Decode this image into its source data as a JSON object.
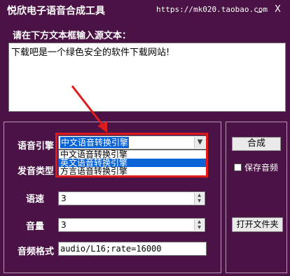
{
  "window": {
    "title": "悦欣电子语音合成工具",
    "url": "https://mk020.taobao.com",
    "minimize": "_",
    "close": "X"
  },
  "source": {
    "prompt": "请在下方文本框输入源文本：",
    "text": "下载吧是一个绿色安全的软件下载网站!"
  },
  "engine": {
    "label": "语音引擎",
    "selected": "中文语音转换引擎",
    "options": [
      "中文语音转换引擎",
      "英文语音转换引擎",
      "方言语音转换引擎"
    ],
    "highlighted_index": 1
  },
  "voice_type": {
    "label": "发音类型"
  },
  "speed": {
    "label": "语速",
    "value": "3"
  },
  "volume": {
    "label": "音量",
    "value": "3"
  },
  "format": {
    "label": "音频格式",
    "value": "audio/L16;rate=16000"
  },
  "buttons": {
    "synthesize": "合成",
    "save_audio": "保存音频",
    "open_folder": "打开文件夹"
  },
  "icons": {
    "dropdown": "chevron-down-icon",
    "spin_up": "arrow-up-icon",
    "spin_down": "arrow-down-icon",
    "annotation": "red-arrow"
  },
  "colors": {
    "background": "#4a1245",
    "highlight_border": "#e01b1b",
    "selection": "#0a64d8"
  }
}
